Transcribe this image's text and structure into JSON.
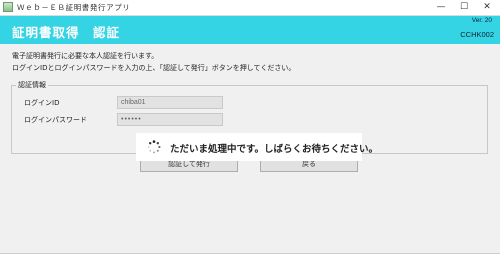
{
  "window": {
    "title": "Ｗｅｂ－ＥＢ証明書発行アプリ",
    "minimize_glyph": "—",
    "maximize_glyph": "☐",
    "close_glyph": "✕"
  },
  "header": {
    "version": "Ver. 20",
    "title": "証明書取得　認証",
    "screen_id": "CCHK002",
    "background_color": "#34d4e4"
  },
  "instructions": {
    "line1": "電子証明書発行に必要な本人認証を行います。",
    "line2": "ログインIDとログインパスワードを入力の上、「認証して発行」ボタンを押してください。"
  },
  "auth_group": {
    "legend": "認証情報",
    "login_id_label": "ログインID",
    "login_id_value": "chiba01",
    "password_label": "ログインパスワード",
    "password_value": "••••••"
  },
  "buttons": {
    "authenticate_label": "認証して発行",
    "back_label": "戻る"
  },
  "loading": {
    "icon": "spinner-icon",
    "message": "ただいま処理中です。しばらくお待ちください。"
  }
}
